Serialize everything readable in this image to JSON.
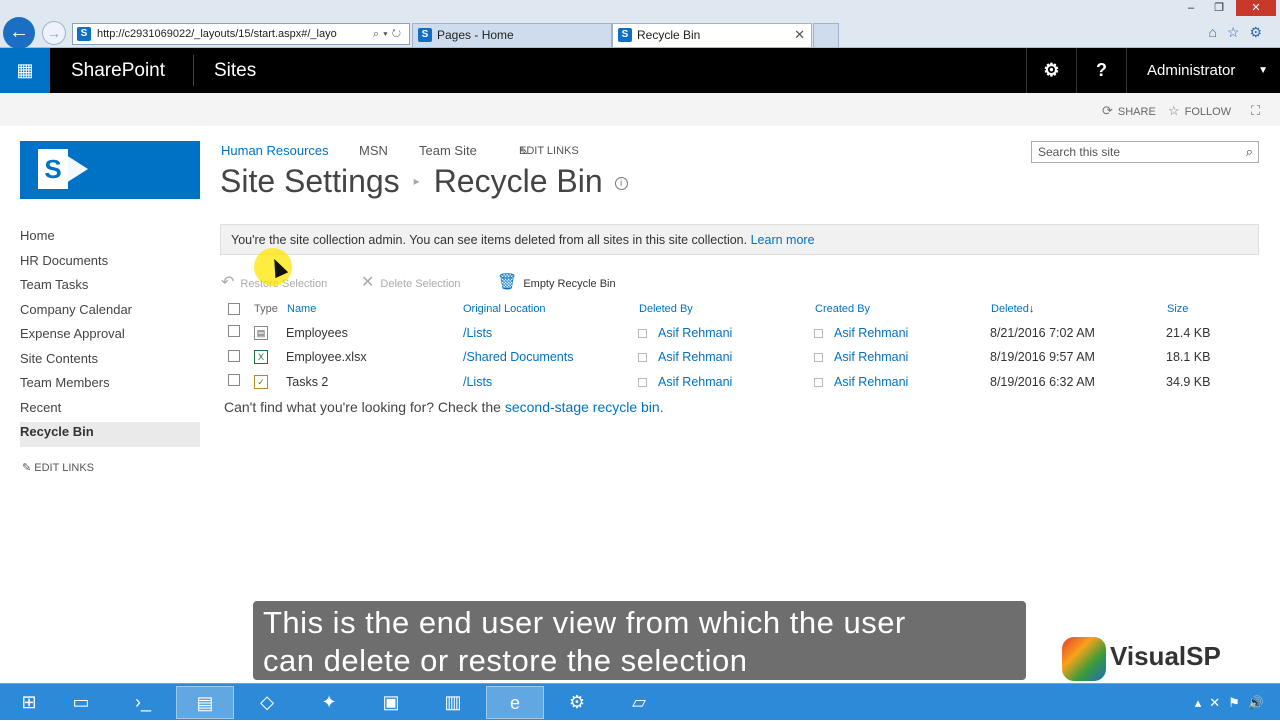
{
  "browser": {
    "address": "http://c2931069022/_layouts/15/start.aspx#/_layo",
    "tabs": [
      {
        "label": "Pages - Home"
      },
      {
        "label": "Recycle Bin"
      }
    ],
    "window_controls": [
      "–",
      "❐",
      "✕"
    ]
  },
  "suitebar": {
    "brand": "SharePoint",
    "sites": "Sites",
    "user": "Administrator"
  },
  "ribbon": {
    "share": "SHARE",
    "follow": "FOLLOW"
  },
  "topnav": {
    "items": [
      "Human Resources",
      "MSN",
      "Team Site"
    ],
    "edit_links": "EDIT LINKS"
  },
  "search": {
    "placeholder": "Search this site"
  },
  "title": {
    "parent": "Site Settings",
    "current": "Recycle Bin"
  },
  "leftnav": {
    "items": [
      "Home",
      "HR Documents",
      "Team Tasks",
      "Company Calendar",
      "Expense Approval",
      "Site Contents",
      "Team Members",
      "Recent",
      "Recycle Bin"
    ],
    "edit_links": "EDIT LINKS"
  },
  "notice": {
    "text": "You're the site collection admin. You can see items deleted from all sites in this site collection.",
    "link": "Learn more"
  },
  "toolbar": {
    "restore": "Restore Selection",
    "delete": "Delete Selection",
    "empty": "Empty Recycle Bin"
  },
  "table": {
    "headers": {
      "type": "Type",
      "name": "Name",
      "original_location": "Original Location",
      "deleted_by": "Deleted By",
      "created_by": "Created By",
      "deleted": "Deleted",
      "size": "Size"
    },
    "rows": [
      {
        "type_icon": "list-icon",
        "name": "Employees",
        "location": "/Lists",
        "deleted_by": "Asif Rehmani",
        "created_by": "Asif Rehmani",
        "deleted": "8/21/2016 7:02 AM",
        "size": "21.4 KB"
      },
      {
        "type_icon": "excel-icon",
        "name": "Employee.xlsx",
        "location": "/Shared Documents",
        "deleted_by": "Asif Rehmani",
        "created_by": "Asif Rehmani",
        "deleted": "8/19/2016 9:57 AM",
        "size": "18.1 KB"
      },
      {
        "type_icon": "tasks-icon",
        "name": "Tasks 2",
        "location": "/Lists",
        "deleted_by": "Asif Rehmani",
        "created_by": "Asif Rehmani",
        "deleted": "8/19/2016 6:32 AM",
        "size": "34.9 KB"
      }
    ]
  },
  "footer": {
    "text": "Can't find what you're looking for? Check the",
    "link": "second-stage recycle bin."
  },
  "caption": {
    "line1": "This is the end user view from which the user",
    "line2": "can delete or restore the selection"
  },
  "watermark": {
    "text": "VisualSP"
  },
  "colors": {
    "accent": "#0072c6",
    "suitebar": "#000000",
    "taskbar": "#2c8ad8"
  }
}
